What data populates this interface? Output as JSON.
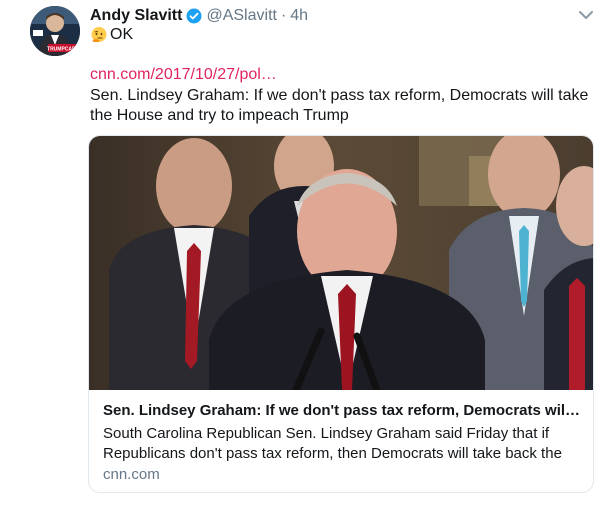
{
  "tweet": {
    "author_name": "Andy Slavitt",
    "handle": "@ASlavitt",
    "separator": "·",
    "time": "4h",
    "text": "OK",
    "avatar_badge_text": "TRUMPCARE",
    "link": "cnn.com/2017/10/27/pol…",
    "body": "Sen. Lindsey Graham: If we don't pass tax reform, Democrats will take the House and try to impeach Trump"
  },
  "card": {
    "title": "Sen. Lindsey Graham: If we don't pass tax reform, Democrats will tak…",
    "description": "South Carolina Republican Sen. Lindsey Graham said Friday that if Republicans don't pass tax reform, then Democrats will take back the",
    "domain": "cnn.com"
  },
  "colors": {
    "link": "#e0245e",
    "verified": "#1da1f2",
    "secondary_text": "#657786",
    "card_border": "#e1e8ed"
  },
  "icons": {
    "verified": "verified-badge-icon",
    "emoji": "thinking-face-emoji",
    "caret": "chevron-down-icon"
  }
}
